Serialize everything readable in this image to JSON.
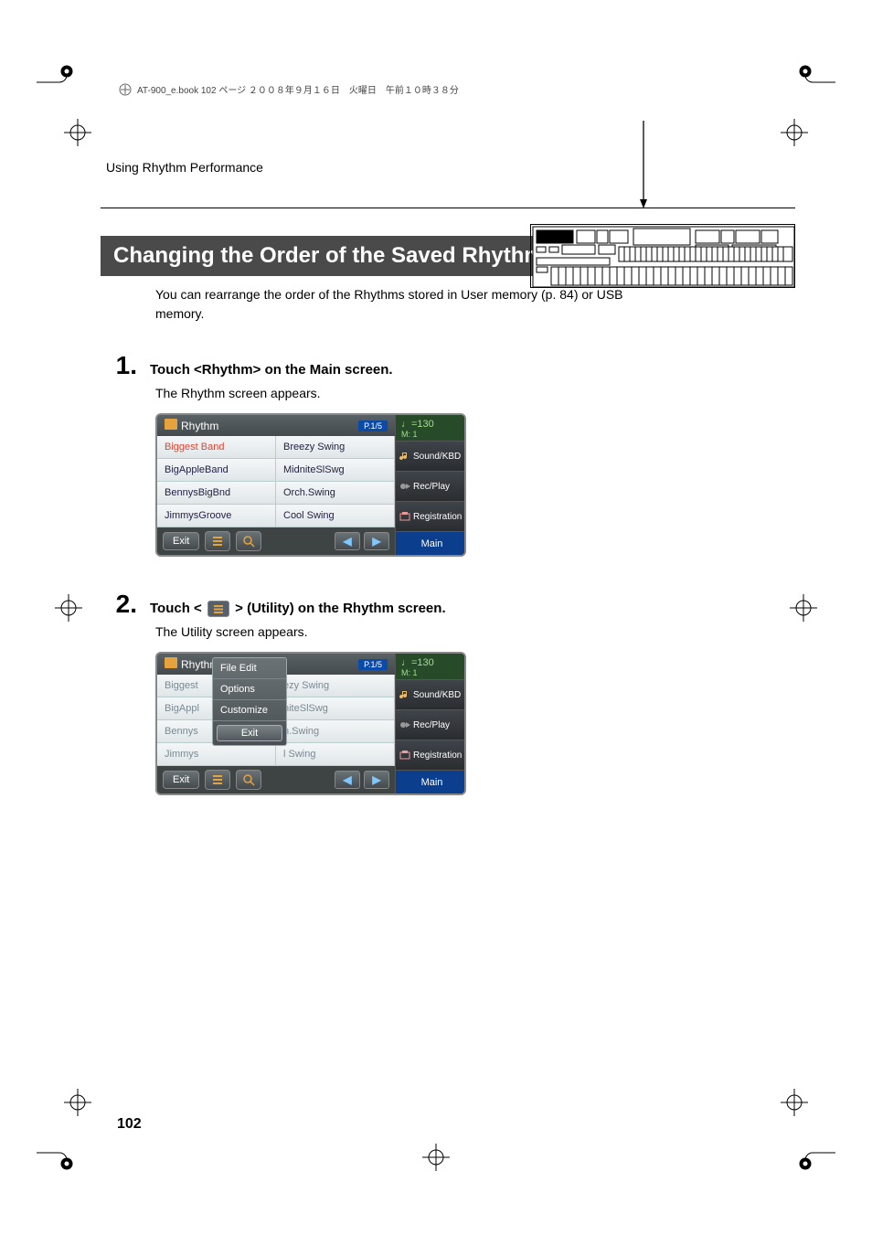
{
  "book_header": "AT-900_e.book  102 ページ  ２００８年９月１６日　火曜日　午前１０時３８分",
  "section_title": "Using Rhythm Performance",
  "bar_title": "Changing the Order of the Saved Rhythms",
  "intro": "You can rearrange the order of the Rhythms stored in User memory (p. 84) or USB memory.",
  "steps": [
    {
      "num": "1.",
      "instr": "Touch <Rhythm> on the Main screen.",
      "sub": "The Rhythm screen appears."
    },
    {
      "num": "2.",
      "instr_pre": "Touch <",
      "instr_post": "> (Utility) on the Rhythm screen.",
      "sub": "The Utility screen appears."
    }
  ],
  "screen1": {
    "title": "Rhythm",
    "page_badge": "P.1/5",
    "rows": [
      [
        "Biggest Band",
        "Breezy Swing"
      ],
      [
        "BigAppleBand",
        "MidniteSlSwg"
      ],
      [
        "BennysBigBnd",
        "Orch.Swing"
      ],
      [
        "JimmysGroove",
        "Cool Swing"
      ]
    ],
    "selected": "Biggest Band",
    "footer": {
      "exit": "Exit"
    },
    "tempo": {
      "bpm_label": "♩=130",
      "measure_label": "M:    1"
    },
    "side": [
      "Sound/KBD",
      "Rec/Play",
      "Registration"
    ],
    "main": "Main"
  },
  "screen2": {
    "title": "Rhythm",
    "page_badge": "P.1/5",
    "rows_left": [
      "Biggest",
      "BigAppl",
      "Bennys",
      "Jimmys"
    ],
    "rows_right": [
      "ezy Swing",
      "niteSlSwg",
      "h.Swing",
      "l Swing"
    ],
    "popup": {
      "items": [
        "File Edit",
        "Options",
        "Customize"
      ],
      "exit": "Exit"
    },
    "footer": {
      "exit": "Exit"
    },
    "tempo": {
      "bpm_label": "♩=130",
      "measure_label": "M:    1"
    },
    "side": [
      "Sound/KBD",
      "Rec/Play",
      "Registration"
    ],
    "main": "Main"
  },
  "page_number": "102"
}
